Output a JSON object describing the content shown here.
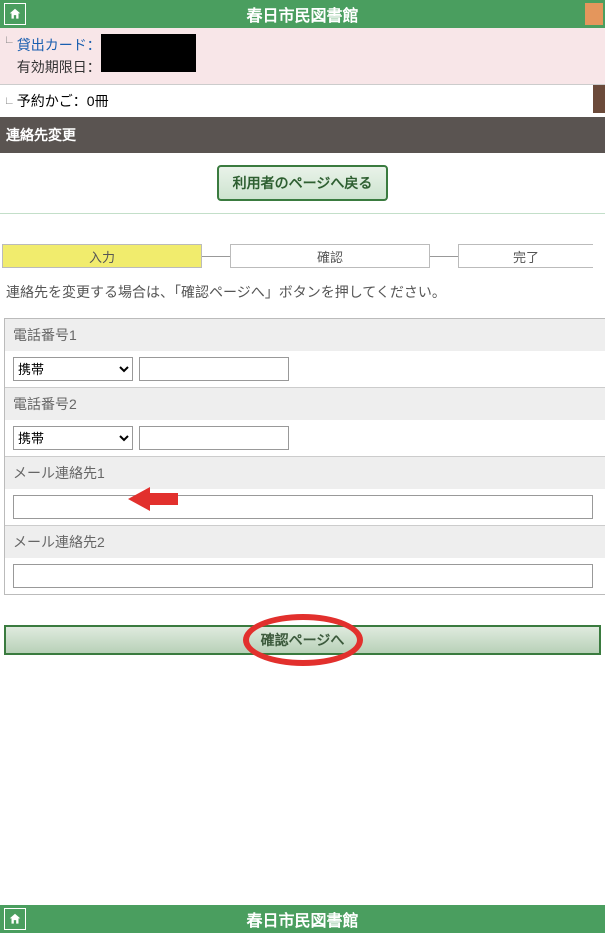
{
  "header": {
    "title": "春日市民図書館"
  },
  "card": {
    "loan_card_label": "貸出カード：",
    "expiry_label": "有効期限日："
  },
  "basket": {
    "label": "予約かご：",
    "count": "0冊"
  },
  "section": {
    "title": "連絡先変更"
  },
  "back_button": {
    "label": "利用者のページへ戻る"
  },
  "steps": {
    "s1": "入力",
    "s2": "確認",
    "s3": "完了"
  },
  "instruction": "連絡先を変更する場合は、「確認ページへ」ボタンを押してください。",
  "form": {
    "phone1_label": "電話番号1",
    "phone2_label": "電話番号2",
    "email1_label": "メール連絡先1",
    "email2_label": "メール連絡先2",
    "phone_type_option": "携帯",
    "phone1_value": "",
    "phone2_value": "",
    "email1_value": "",
    "email2_value": ""
  },
  "confirm_button": {
    "label": "確認ページへ"
  },
  "footer": {
    "title": "春日市民図書館"
  }
}
